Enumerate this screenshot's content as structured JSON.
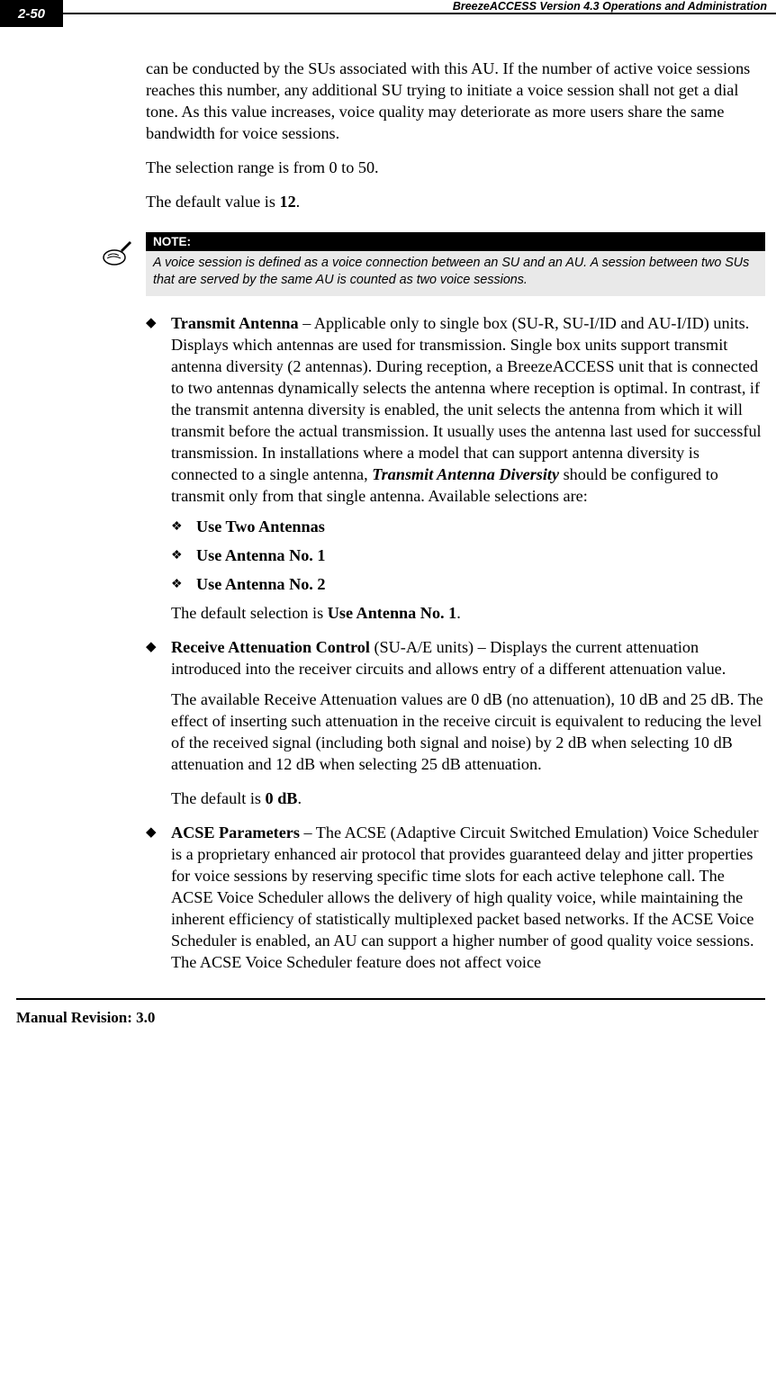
{
  "header": {
    "page_number": "2-50",
    "doc_title": "BreezeACCESS Version 4.3 Operations and Administration"
  },
  "intro": {
    "p1": "can be conducted by the SUs associated with this AU. If the number of active voice sessions reaches this number, any additional SU trying to initiate a voice session shall not get a dial tone. As this value increases, voice quality may deteriorate as more users share the same bandwidth for voice sessions.",
    "p2": "The selection range is from 0 to 50.",
    "p3_pre": "The default value is ",
    "p3_bold": "12",
    "p3_post": "."
  },
  "note": {
    "label": "NOTE:",
    "body": "A voice session is defined as a voice connection between an SU and an AU. A session between two SUs that are served by the same AU is counted as two voice sessions."
  },
  "transmit": {
    "title": "Transmit Antenna ",
    "dash": "– ",
    "body1": "Applicable only to single box (SU-R, SU-I/ID and AU-I/ID) units. Displays which antennas are used for transmission. Single box units support transmit antenna diversity (2 antennas). During reception, a BreezeACCESS unit that is connected to two antennas dynamically selects the antenna where reception is optimal. In contrast, if the transmit antenna diversity is enabled, the unit selects the antenna from which it will transmit before the actual transmission. It usually uses the antenna last used for successful transmission. In installations where a model that can support antenna diversity is connected to a single antenna, ",
    "diversity": "Transmit Antenna Diversity",
    "body2": " should be configured to transmit only from that single antenna. Available selections are:",
    "opt1": "Use Two Antennas",
    "opt2": "Use Antenna No. 1",
    "opt3": "Use Antenna No. 2",
    "default_pre": "The default selection is ",
    "default_bold": "Use Antenna No. 1",
    "default_post": "."
  },
  "receive": {
    "title": "Receive Attenuation Control",
    "body1": " (SU-A/E units) – Displays the current attenuation introduced into the receiver circuits and allows entry of a different attenuation value.",
    "p2": "The available Receive Attenuation values are 0 dB (no attenuation), 10 dB and 25 dB. The effect of inserting such attenuation in the receive circuit is equivalent to reducing the level of the received signal (including both signal and noise) by 2 dB when selecting 10 dB attenuation and 12 dB when selecting 25 dB attenuation.",
    "p3_pre": "The default is ",
    "p3_bold": "0 dB",
    "p3_post": "."
  },
  "acse": {
    "title": "ACSE Parameters",
    "body": " – The ACSE (Adaptive Circuit Switched Emulation) Voice Scheduler is a proprietary enhanced air protocol that provides guaranteed delay and jitter properties for voice sessions by reserving specific time slots for each active telephone call. The ACSE Voice Scheduler allows the delivery of high quality voice, while maintaining the inherent efficiency of statistically multiplexed packet based networks. If the ACSE Voice Scheduler is enabled, an AU can support a higher number of good quality voice sessions. The ACSE Voice Scheduler feature does not affect voice"
  },
  "footer": {
    "revision": "Manual Revision: 3.0"
  }
}
